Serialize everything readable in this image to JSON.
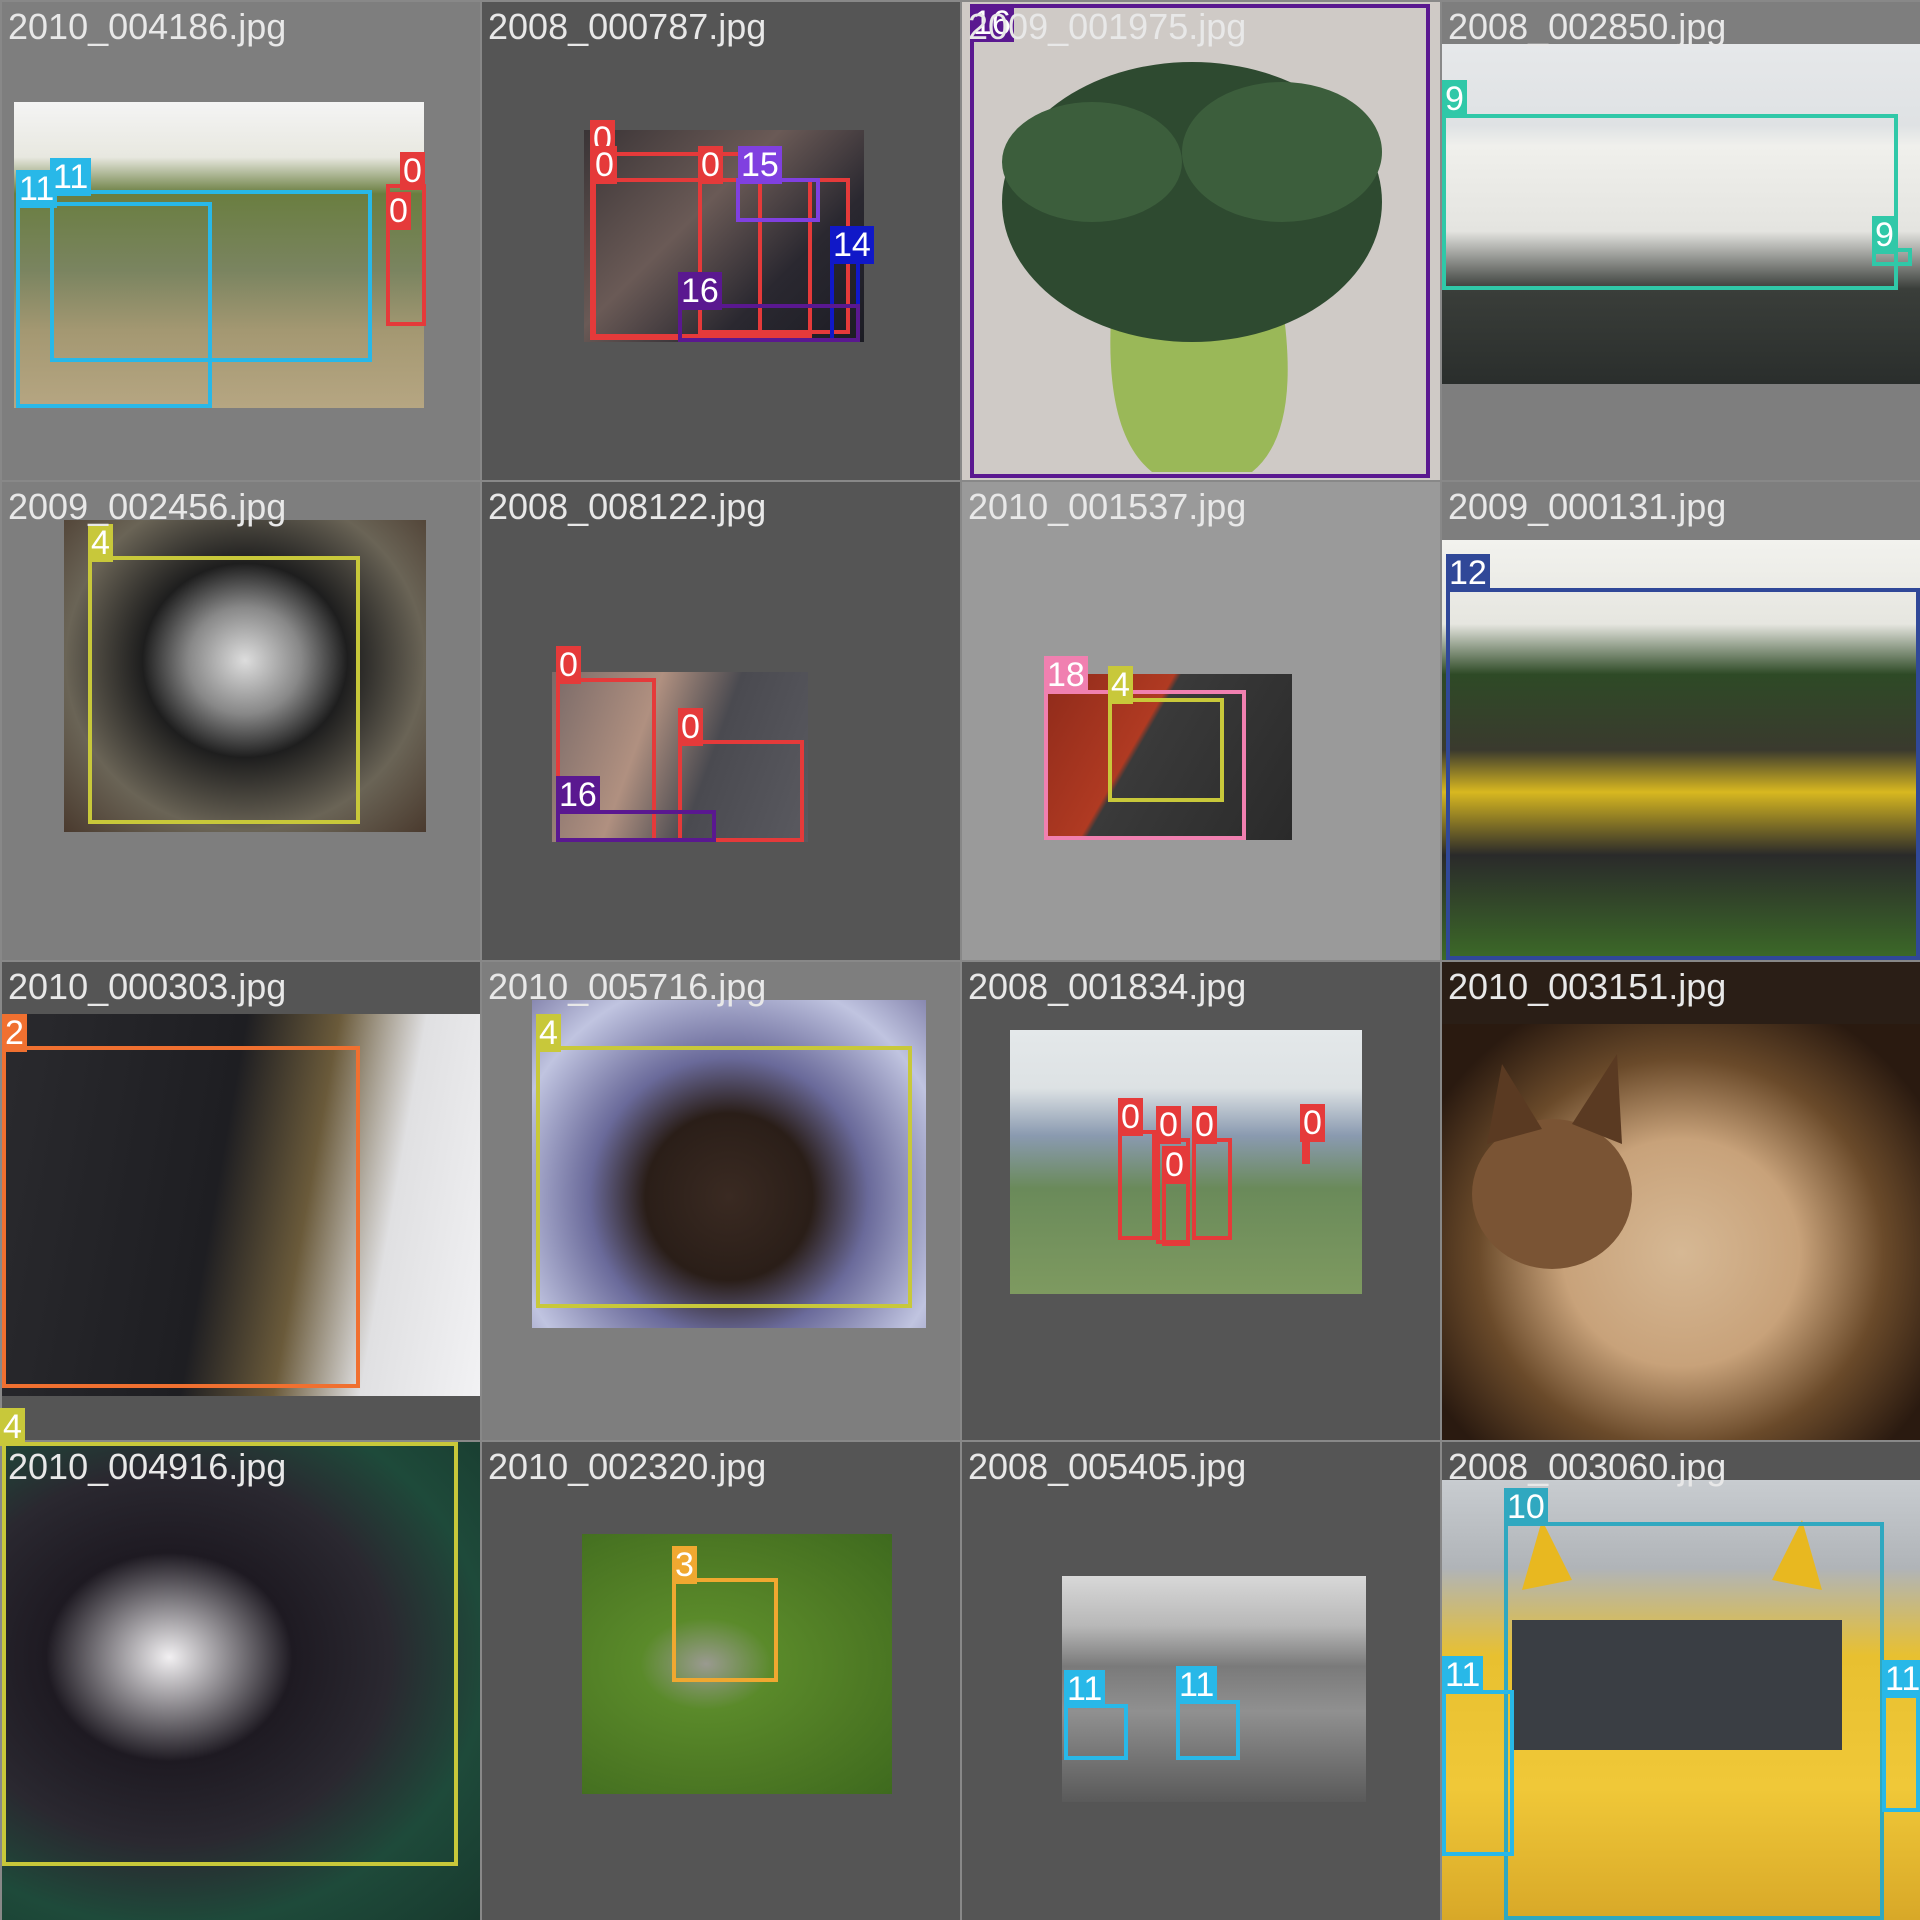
{
  "tiles": [
    {
      "filename": "2010_004186.jpg",
      "labels": [
        "11",
        "11",
        "0",
        "0"
      ]
    },
    {
      "filename": "2008_000787.jpg",
      "labels": [
        "0",
        "0",
        "0",
        "15",
        "14",
        "16"
      ]
    },
    {
      "filename": "2009_001975.jpg",
      "labels": [
        "16"
      ]
    },
    {
      "filename": "2008_002850.jpg",
      "labels": [
        "9",
        "9"
      ]
    },
    {
      "filename": "2009_002456.jpg",
      "labels": [
        "4"
      ]
    },
    {
      "filename": "2008_008122.jpg",
      "labels": [
        "0",
        "0",
        "16"
      ]
    },
    {
      "filename": "2010_001537.jpg",
      "labels": [
        "18",
        "4"
      ]
    },
    {
      "filename": "2009_000131.jpg",
      "labels": [
        "12"
      ]
    },
    {
      "filename": "2010_000303.jpg",
      "labels": [
        "2"
      ]
    },
    {
      "filename": "2010_005716.jpg",
      "labels": [
        "4"
      ]
    },
    {
      "filename": "2008_001834.jpg",
      "labels": [
        "0",
        "0",
        "0",
        "0",
        "0"
      ]
    },
    {
      "filename": "2010_003151.jpg",
      "labels": []
    },
    {
      "filename": "2010_004916.jpg",
      "labels": [
        "4"
      ]
    },
    {
      "filename": "2010_002320.jpg",
      "labels": [
        "3"
      ]
    },
    {
      "filename": "2008_005405.jpg",
      "labels": [
        "11",
        "11"
      ]
    },
    {
      "filename": "2008_003060.jpg",
      "labels": [
        "10",
        "11",
        "11"
      ]
    }
  ],
  "class_colors": {
    "0": "#e53a3a",
    "2": "#f07030",
    "3": "#f0a830",
    "4": "#c8c83a",
    "9": "#30c8a8",
    "10": "#30a8c0",
    "11": "#28b8e8",
    "12": "#304898",
    "14": "#1018c8",
    "15": "#8040e0",
    "16": "#5a1890",
    "18": "#f080b0"
  }
}
